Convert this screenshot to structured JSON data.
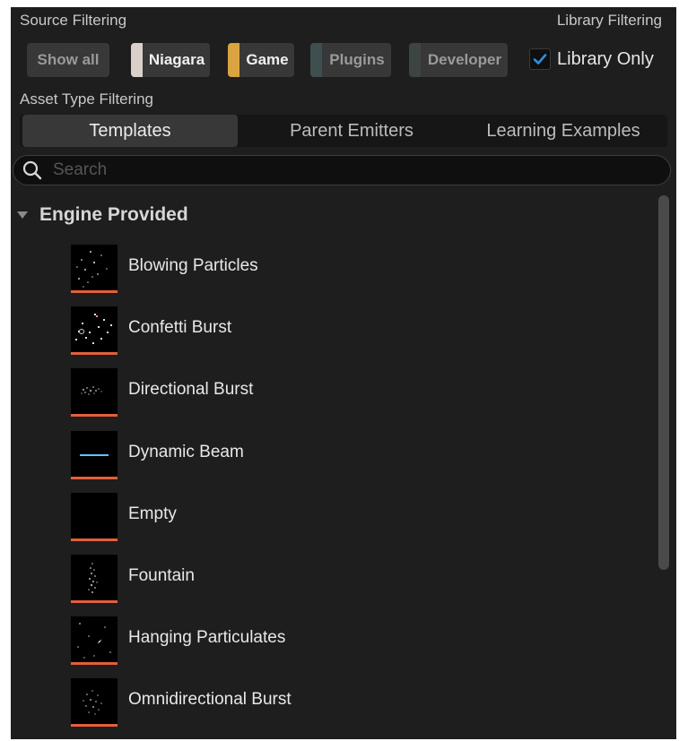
{
  "source_filtering": {
    "label": "Source Filtering",
    "chips": [
      {
        "label": "Show all",
        "color": null,
        "active": false
      },
      {
        "label": "Niagara",
        "color": "#d9d0cc",
        "active": true
      },
      {
        "label": "Game",
        "color": "#d9a441",
        "active": true
      },
      {
        "label": "Plugins",
        "color": "#3f4f50",
        "active": false
      },
      {
        "label": "Developer",
        "color": "#3d4540",
        "active": false
      }
    ]
  },
  "library_filtering": {
    "label": "Library Filtering",
    "library_only_label": "Library Only",
    "library_only_checked": true
  },
  "asset_type_filtering": {
    "label": "Asset Type Filtering",
    "tabs": [
      {
        "label": "Templates",
        "active": true
      },
      {
        "label": "Parent Emitters",
        "active": false
      },
      {
        "label": "Learning Examples",
        "active": false
      }
    ]
  },
  "search": {
    "placeholder": "Search",
    "value": ""
  },
  "group": {
    "title": "Engine Provided",
    "expanded": true,
    "items": [
      {
        "label": "Blowing Particles",
        "thumb": "sparse-particles"
      },
      {
        "label": "Confetti Burst",
        "thumb": "confetti"
      },
      {
        "label": "Directional Burst",
        "thumb": "burst-cloud"
      },
      {
        "label": "Dynamic Beam",
        "thumb": "beam-line"
      },
      {
        "label": "Empty",
        "thumb": "empty"
      },
      {
        "label": "Fountain",
        "thumb": "fountain"
      },
      {
        "label": "Hanging Particulates",
        "thumb": "hanging-dots"
      },
      {
        "label": "Omnidirectional Burst",
        "thumb": "omni-burst"
      }
    ]
  },
  "colors": {
    "accent_check": "#2f8fe0",
    "thumb_underline": "#e2603a",
    "beam": "#3bb6ff"
  }
}
